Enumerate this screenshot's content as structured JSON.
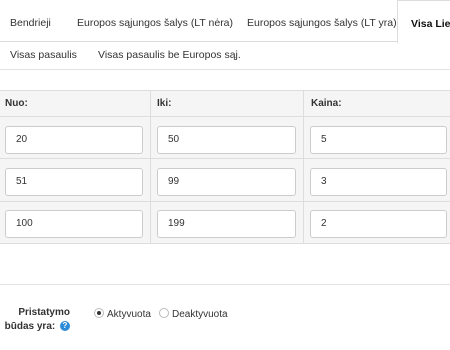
{
  "tabs": {
    "row1": [
      "Bendrieji",
      "Europos sąjungos šalys (LT nėra)",
      "Europos sąjungos šalys (LT yra)",
      "Visa Lietuva"
    ],
    "row2": [
      "Visas pasaulis",
      "Visas pasaulis be Europos sąj."
    ],
    "active": "Visa Lietuva"
  },
  "table": {
    "headers": [
      "Nuo:",
      "Iki:",
      "Kaina:"
    ],
    "rows": [
      [
        "20",
        "50",
        "5"
      ],
      [
        "51",
        "99",
        "3"
      ],
      [
        "100",
        "199",
        "2"
      ]
    ]
  },
  "delivery": {
    "label": "Pristatymo būdas yra:",
    "label_line1": "Pristatymo",
    "label_line2": "būdas yra:",
    "help_icon": "question-circle-icon",
    "options": [
      "Aktyvuota",
      "Deaktyvuota"
    ],
    "selected": "Aktyvuota"
  },
  "colors": {
    "help_icon": "#2e8cd6",
    "grid_bg": "#f5f5f5"
  }
}
